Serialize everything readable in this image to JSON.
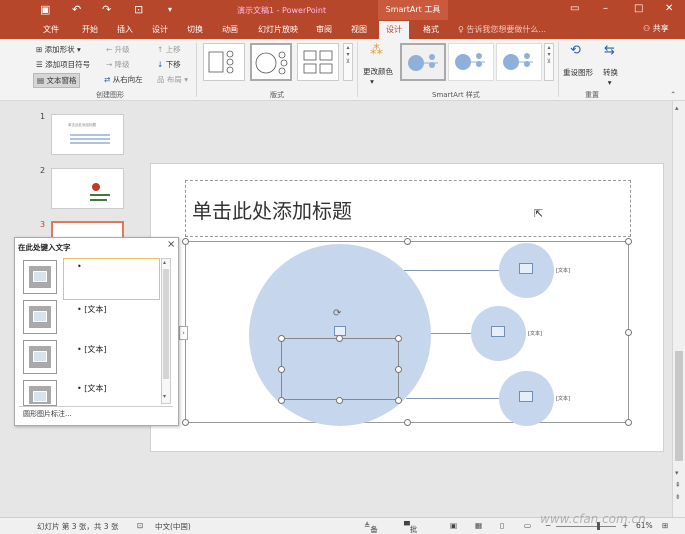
{
  "titlebar": {
    "doc_title": "演示文稿1 - PowerPoint",
    "context_title": "SmartArt 工具",
    "quick_access": [
      "save",
      "undo",
      "redo",
      "start-from-beginning"
    ]
  },
  "tabs": [
    "文件",
    "开始",
    "插入",
    "设计",
    "切换",
    "动画",
    "幻灯片放映",
    "审阅",
    "视图",
    "设计",
    "格式"
  ],
  "active_tab": "设计",
  "tell_me": "告诉我您想要做什么...",
  "share": "共享",
  "ribbon": {
    "create_graphic": {
      "add_shape": "添加形状",
      "add_bullet": "添加项目符号",
      "text_pane": "文本窗格",
      "promote": "升级",
      "demote": "降级",
      "right_to_left": "从右向左",
      "move_up": "上移",
      "move_down": "下移",
      "layout": "布局",
      "label": "创建图形"
    },
    "layouts_label": "版式",
    "change_colors": "更改颜色",
    "smartart_styles_label": "SmartArt 样式",
    "reset_graphic": "重设图形",
    "convert": "转换",
    "reset_label": "重置"
  },
  "slides": [
    {
      "num": "1",
      "thumb_text": "单击此处添加标题"
    },
    {
      "num": "2"
    },
    {
      "num": "3"
    }
  ],
  "slide": {
    "title_placeholder": "单击此处添加标题",
    "text_labels": [
      "[文本]",
      "[文本]",
      "[文本]"
    ]
  },
  "text_pane": {
    "header": "在此处键入文字",
    "items": [
      "",
      "[文本]",
      "[文本]",
      "[文本]"
    ],
    "footer": "圆形图片标注..."
  },
  "statusbar": {
    "slide_info": "幻灯片 第 3 张，共 3 张",
    "language": "中文(中国)",
    "notes": "备注",
    "comments": "批注",
    "zoom": "61%"
  },
  "watermark": "www.cfan.com.cn",
  "colors": {
    "accent": "#b7472a",
    "shape_fill": "#c6d6ec"
  }
}
